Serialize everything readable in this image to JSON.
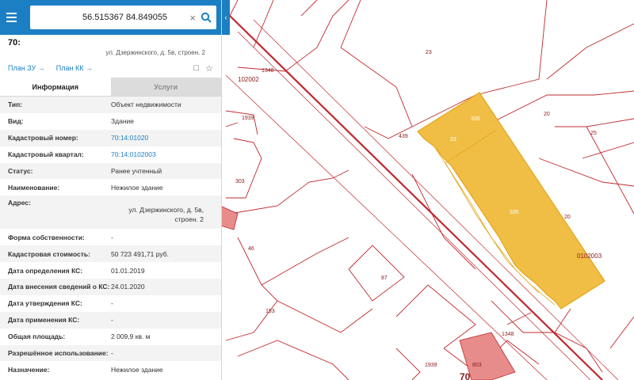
{
  "search": {
    "type": "ОКС",
    "query": "56.515367 84.849055",
    "close_glyph": "×",
    "collapse_glyph": "‹"
  },
  "object": {
    "number": "70:",
    "address_short": "ул. Дзержинского, д. 5в, строен. 2"
  },
  "links": {
    "plan_zu": "План ЗУ →",
    "plan_kk": "План КК →",
    "icons": [
      "map-search-icon",
      "star-icon"
    ]
  },
  "tabs": {
    "info": "Информация",
    "services": "Услуги"
  },
  "fields": [
    {
      "label": "Тип:",
      "value": "Объект недвижимости"
    },
    {
      "label": "Вид:",
      "value": "Здание"
    },
    {
      "label": "Кадастровый номер:",
      "value": "70:14:01020",
      "link": true
    },
    {
      "label": "Кадастровый квартал:",
      "value": "70:14:0102003",
      "link": true
    },
    {
      "label": "Статус:",
      "value": "Ранее учтенный"
    },
    {
      "label": "Наименование:",
      "value": "Нежилое здание"
    },
    {
      "label": "Адрес:",
      "value": "ул. Дзержинского, д. 5в, строен. 2",
      "tall": true
    },
    {
      "label": "Форма собственности:",
      "value": "-"
    },
    {
      "label": "Кадастровая стоимость:",
      "value": "50 723 491,71 руб."
    },
    {
      "label": "Дата определения КС:",
      "value": "01.01.2019"
    },
    {
      "label": "Дата внесения сведений о КС:",
      "value": "24.01.2020"
    },
    {
      "label": "Дата утверждения КС:",
      "value": "-"
    },
    {
      "label": "Дата применения КС:",
      "value": "-"
    },
    {
      "label": "Общая площадь:",
      "value": "2 009,9 кв. м"
    },
    {
      "label": "Разрешённое использование:",
      "value": "-"
    },
    {
      "label": "Назначение:",
      "value": "Нежилое здание"
    }
  ],
  "map": {
    "labels": [
      "23",
      "20",
      "25",
      "1348",
      "102002",
      "1939",
      "439",
      "23",
      "335",
      "335",
      "20",
      "0102003",
      "303",
      "46",
      "87",
      "153",
      "1348",
      "1939",
      "803",
      "70"
    ],
    "colors": {
      "parcel_line": "#c0282d",
      "selected_fill": "#f0bb3b",
      "selected_stroke": "#e3a51c",
      "rail_line": "#c0282d",
      "pink_fill": "#e88b8b"
    }
  }
}
